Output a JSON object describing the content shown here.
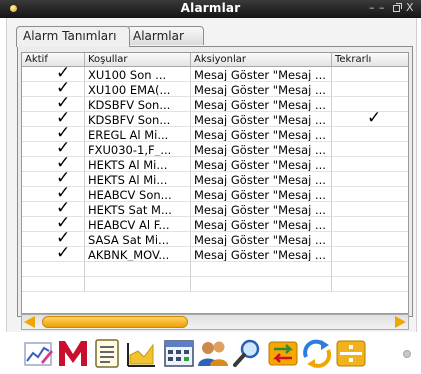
{
  "window": {
    "title": "Alarmlar",
    "controls": [
      "–",
      "–",
      "↗",
      "X"
    ]
  },
  "tabs": [
    {
      "label": "Alarm Tanımları",
      "active": true
    },
    {
      "label": "Alarmlar",
      "active": false
    }
  ],
  "table": {
    "columns": [
      "Aktif",
      "Koşullar",
      "Aksiyonlar",
      "Tekrarlı"
    ],
    "check_glyph": "✓",
    "rows": [
      {
        "aktif": true,
        "kosullar": "XU100 Son ...",
        "aksiyonlar": "Mesaj Göster \"Mesaj ...",
        "tekrarli": false
      },
      {
        "aktif": true,
        "kosullar": "XU100 EMA(...",
        "aksiyonlar": "Mesaj Göster \"Mesaj ...",
        "tekrarli": false
      },
      {
        "aktif": true,
        "kosullar": "KDSBFV Son...",
        "aksiyonlar": "Mesaj Göster \"Mesaj ...",
        "tekrarli": false
      },
      {
        "aktif": true,
        "kosullar": "KDSBFV Son...",
        "aksiyonlar": "Mesaj Göster \"Mesaj ...",
        "tekrarli": true
      },
      {
        "aktif": true,
        "kosullar": "EREGL Al Mi...",
        "aksiyonlar": "Mesaj Göster \"Mesaj ...",
        "tekrarli": false
      },
      {
        "aktif": true,
        "kosullar": "FXU030-1,F_...",
        "aksiyonlar": "Mesaj Göster \"Mesaj ...",
        "tekrarli": false
      },
      {
        "aktif": true,
        "kosullar": "HEKTS Al Mi...",
        "aksiyonlar": "Mesaj Göster \"Mesaj ...",
        "tekrarli": false
      },
      {
        "aktif": true,
        "kosullar": "HEKTS Al Mi...",
        "aksiyonlar": "Mesaj Göster \"Mesaj ...",
        "tekrarli": false
      },
      {
        "aktif": true,
        "kosullar": "HEABCV Son...",
        "aksiyonlar": "Mesaj Göster \"Mesaj ...",
        "tekrarli": false
      },
      {
        "aktif": true,
        "kosullar": "HEKTS Sat M...",
        "aksiyonlar": "Mesaj Göster \"Mesaj ...",
        "tekrarli": false
      },
      {
        "aktif": true,
        "kosullar": "HEABCV Al F...",
        "aksiyonlar": "Mesaj Göster \"Mesaj ...",
        "tekrarli": false
      },
      {
        "aktif": true,
        "kosullar": "SASA Sat Mi...",
        "aksiyonlar": "Mesaj Göster \"Mesaj ...",
        "tekrarli": false
      },
      {
        "aktif": true,
        "kosullar": "AKBNK_MOV...",
        "aksiyonlar": "Mesaj Göster \"Mesaj ...",
        "tekrarli": false
      }
    ],
    "empty_rows": 2
  },
  "scrollbar": {
    "thumb_start_fraction": 0.0,
    "thumb_size_fraction": 0.42
  },
  "toolbar": {
    "icons": [
      "chart-edit-icon",
      "meta-m-icon",
      "document-icon",
      "area-chart-icon",
      "calculator-table-icon",
      "users-icon",
      "search-icon",
      "exchange-icon",
      "refresh-icon",
      "split-window-icon"
    ]
  },
  "colors": {
    "accent": "#f0a600",
    "titlebar": "#1c1c1c",
    "brand_red": "#c8102e"
  }
}
